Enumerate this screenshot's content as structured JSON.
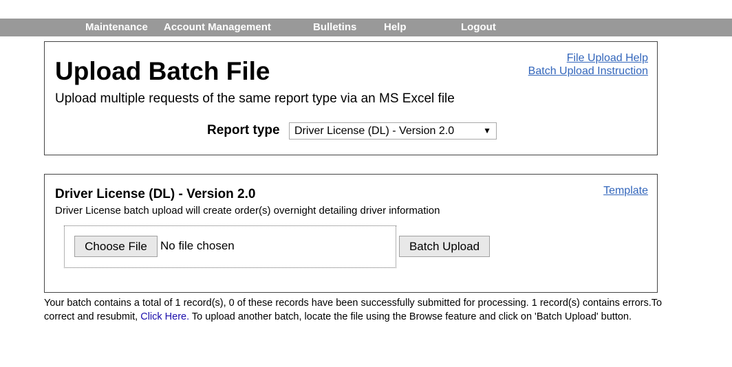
{
  "nav": {
    "items": [
      {
        "label": "Maintenance"
      },
      {
        "label": "Account Management"
      },
      {
        "label": "Bulletins"
      },
      {
        "label": "Help"
      },
      {
        "label": "Logout"
      }
    ]
  },
  "header_panel": {
    "title": "Upload Batch File",
    "subtitle": "Upload multiple requests of the same report type via an MS Excel file",
    "links": {
      "file_upload_help": "File Upload Help",
      "batch_upload_instruction": "Batch Upload Instruction"
    },
    "report_type": {
      "label": "Report type",
      "selected": "Driver License (DL) - Version 2.0"
    }
  },
  "upload_panel": {
    "title": "Driver License (DL) - Version 2.0",
    "description": "Driver License batch upload will create order(s) overnight detailing driver information",
    "template_link": "Template",
    "choose_file_label": "Choose File",
    "file_status": "No file chosen",
    "batch_upload_label": "Batch Upload"
  },
  "message": {
    "part1": "Your batch contains a total of 1 record(s), 0 of these records have been successfully submitted for processing. 1 record(s) contains errors.To correct and resubmit, ",
    "link": "Click Here.",
    "part2": " To upload another batch, locate the file using the Browse feature and click on 'Batch Upload' button."
  },
  "colors": {
    "nav_background": "#999999",
    "nav_text": "#ffffff",
    "link": "#3366bb"
  }
}
